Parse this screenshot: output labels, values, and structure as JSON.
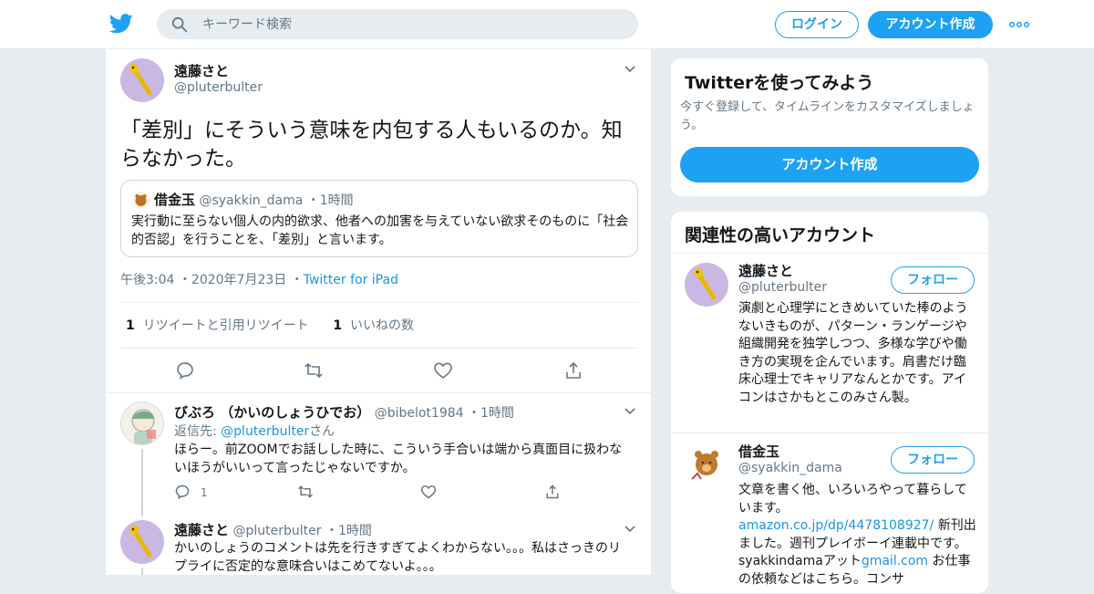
{
  "header": {
    "search_placeholder": "キーワード検索",
    "login_label": "ログイン",
    "signup_label": "アカウント作成"
  },
  "main_tweet": {
    "name": "遠藤さと",
    "handle": "@pluterbulter",
    "text": "「差別」にそういう意味を内包する人もいるのか。知らなかった。",
    "quote": {
      "name": "借金玉",
      "handle": "@syakkin_dama",
      "time": "1時間",
      "text": "実行動に至らない個人の内的欲求、他者への加害を与えていない欲求そのものに「社会的否認」を行うことを、「差別」と言います。"
    },
    "time": "午後3:04",
    "date": "2020年7月23日",
    "source": "Twitter for iPad",
    "retweet_count": "1",
    "retweet_label": "リツイートと引用リツイート",
    "like_count": "1",
    "like_label": "いいねの数"
  },
  "replies": [
    {
      "name": "びぶろ （かいのしょうひでお）",
      "handle": "@bibelot1984",
      "time": "1時間",
      "reply_to_prefix": "返信先: ",
      "reply_to_handle": "@pluterbulter",
      "reply_to_suffix": "さん",
      "text": "ほらー。前ZOOMでお話しした時に、こういう手合いは端から真面目に扱わないほうがいいって言ったじゃないですか。",
      "reply_count": "1"
    },
    {
      "name": "遠藤さと",
      "handle": "@pluterbulter",
      "time": "1時間",
      "text": "かいのしょうのコメントは先を行きすぎてよくわからない。。。私はさっきのリプライに否定的な意味合いはこめてないよ。。。"
    }
  ],
  "sidebar": {
    "try_card": {
      "title": "Twitterを使ってみよう",
      "subtitle": "今すぐ登録して、タイムラインをカスタマイズしましょう。",
      "signup_label": "アカウント作成"
    },
    "relevant": {
      "title": "関連性の高いアカウント",
      "follow_label": "フォロー",
      "accounts": [
        {
          "name": "遠藤さと",
          "handle": "@pluterbulter",
          "bio": "演劇と心理学にときめいていた棒のようないきものが、パターン・ランゲージや組織開発を独学しつつ、多様な学びや働き方の実現を企んでいます。肩書だけ臨床心理士でキャリアなんとかです。アイコンはさかもとこのみさん製。"
        },
        {
          "name": "借金玉",
          "handle": "@syakkin_dama",
          "bio_part1": "文章を書く他、いろいろやって暮らしています。",
          "bio_link1": "amazon.co.jp/dp/4478108927/",
          "bio_part2": " 新刊出ました。週刊プレイボーイ連載中です。 syakkindamaアット",
          "bio_link2": "gmail.com",
          "bio_part3": " お仕事の依頼などはこちら。コンサ"
        }
      ]
    }
  },
  "colors": {
    "accent": "#1da1f2",
    "link": "#1b95e0",
    "text_secondary": "#657786",
    "background": "#e6ecf0"
  }
}
